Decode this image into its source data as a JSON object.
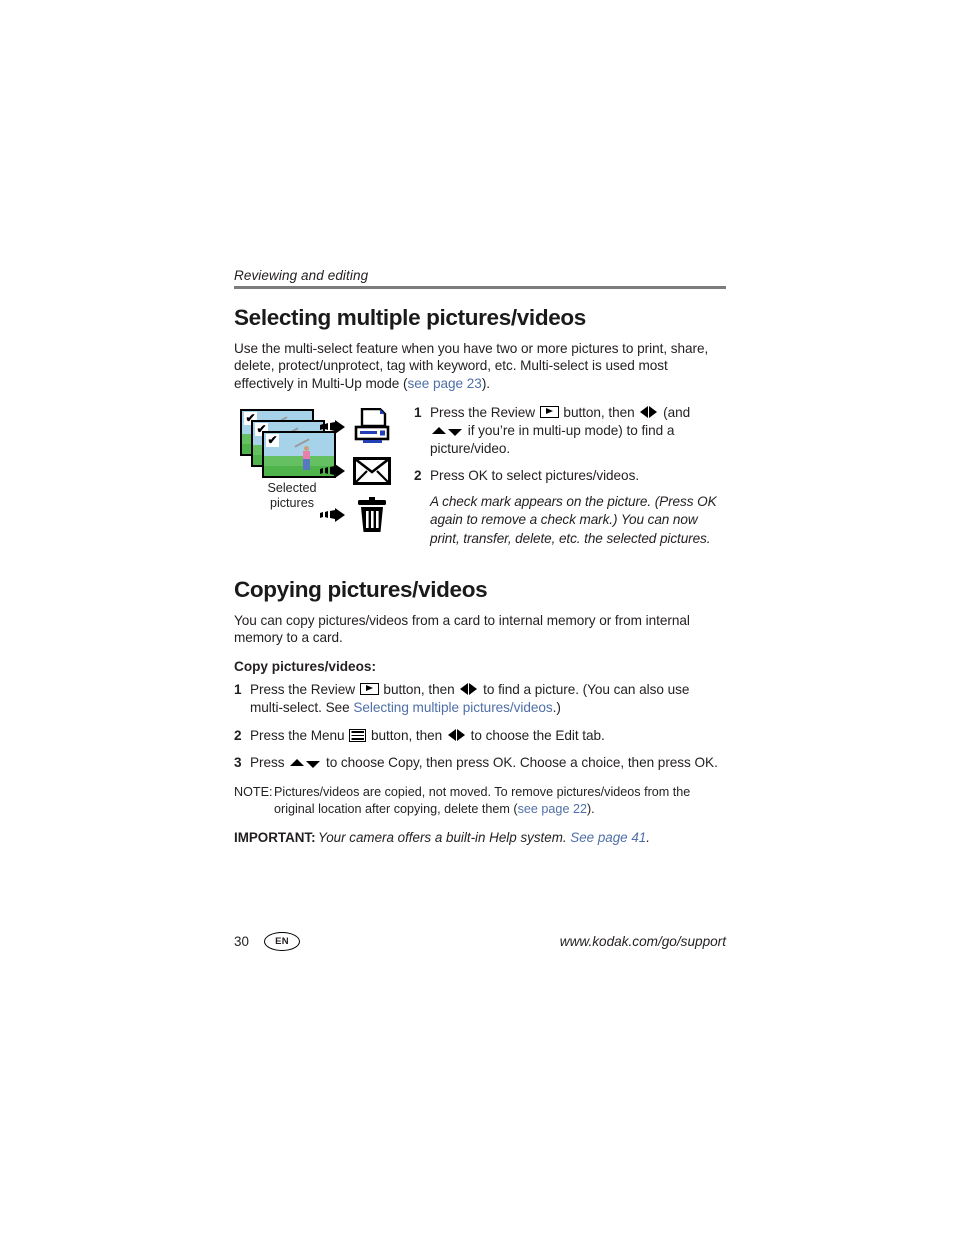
{
  "running_head": "Reviewing and editing",
  "sections": {
    "multiselect": {
      "title": "Selecting multiple pictures/videos",
      "intro_part1": "Use the multi-select feature when you have two or more pictures to print, share, delete, protect/unprotect, tag with keyword, etc. Multi-select is used most effectively in Multi-Up mode (",
      "intro_link": "see page 23",
      "intro_part2": ").",
      "figure": {
        "caption_line1": "Selected",
        "caption_line2": "pictures",
        "thumbnail_check": "✔",
        "destinations": [
          "printer-icon",
          "envelope-icon",
          "trash-icon"
        ],
        "printer_accent_color": "#2340b8"
      },
      "steps": [
        {
          "num": "1",
          "text_a": "Press the Review ",
          "icon_a": "review-button-icon",
          "text_b": " button, then ",
          "icon_b": "left-right-arrows-icon",
          "text_c": " (and ",
          "icon_c": "up-down-arrows-icon",
          "text_d": " if you’re in multi-up mode) to find a picture/video."
        },
        {
          "num": "2",
          "text_a": "Press OK to select pictures/videos."
        }
      ],
      "step2_note": "A check mark appears on the picture. (Press OK again to remove a check mark.) You can now print, transfer, delete, etc. the selected pictures."
    },
    "copying": {
      "title": "Copying pictures/videos",
      "intro": "You can copy pictures/videos from a card to internal memory or from internal memory to a card.",
      "subhead": "Copy pictures/videos:",
      "steps": [
        {
          "num": "1",
          "text_a": "Press the Review ",
          "icon_a": "review-button-icon",
          "text_b": " button, then ",
          "icon_b": "left-right-arrows-icon",
          "text_c": " to find a picture. (You can also use multi-select. See ",
          "link": "Selecting multiple pictures/videos",
          "text_d": ".)"
        },
        {
          "num": "2",
          "text_a": "Press the Menu ",
          "icon_a": "menu-button-icon",
          "text_b": " button, then ",
          "icon_b": "left-right-arrows-icon",
          "text_c": " to choose the Edit tab."
        },
        {
          "num": "3",
          "text_a": "Press ",
          "icon_a": "up-down-arrows-icon",
          "text_b": " to choose Copy, then press OK. Choose a choice, then press OK."
        }
      ],
      "note": {
        "label": "NOTE:",
        "text_a": "Pictures/videos are copied, not moved. To remove pictures/videos from the original location after copying, delete them (",
        "link": "see page 22",
        "text_b": ")."
      },
      "important": {
        "label": "IMPORTANT:",
        "text_a": "Your camera offers a built-in Help system. ",
        "link": "See page 41",
        "text_b": "."
      }
    }
  },
  "footer": {
    "page_number": "30",
    "language_badge": "EN",
    "url": "www.kodak.com/go/support"
  },
  "colors": {
    "link": "#4f6fa8",
    "rule": "#7c7c7c",
    "text": "#231f20"
  }
}
